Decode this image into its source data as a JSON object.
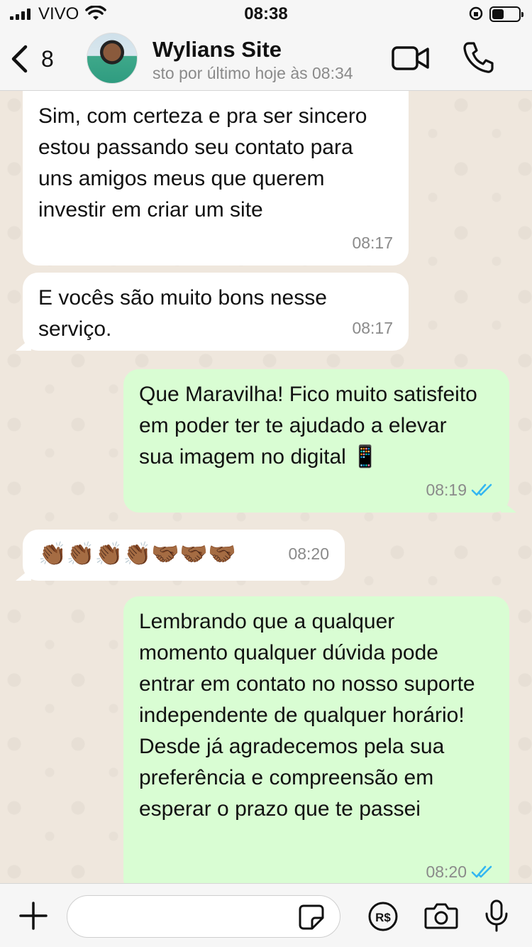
{
  "status_bar": {
    "carrier": "VIVO",
    "time": "08:38",
    "battery_level": 0.45
  },
  "header": {
    "back_count": "8",
    "contact_name": "Wylians Site",
    "contact_status": "sto por último hoje às 08:34",
    "icons": [
      "chevron-left-icon",
      "video-camera-icon",
      "phone-icon"
    ]
  },
  "messages": [
    {
      "direction": "in",
      "text": "Sim, com certeza e pra ser sincero estou passando seu contato para uns amigos meus que querem investir em criar um site",
      "time": "08:17"
    },
    {
      "direction": "in",
      "text": "E vocês são muito bons nesse serviço.",
      "time": "08:17"
    },
    {
      "direction": "out",
      "text": "Que Maravilha! Fico muito satisfeito em poder ter te ajudado a elevar sua imagem no digital 📱",
      "time": "08:19",
      "read": true
    },
    {
      "direction": "in",
      "text": "👏🏾👏🏾👏🏾👏🏾🤝🏾🤝🏾🤝🏾",
      "time": "08:20"
    },
    {
      "direction": "out",
      "text": "Lembrando que a qualquer momento qualquer dúvida pode entrar em contato no nosso suporte independente de qualquer horário! Desde já agradecemos pela sua preferência e compreensão em esperar o prazo que te passei",
      "time": "08:20",
      "read": true
    }
  ],
  "input_bar": {
    "placeholder": "",
    "icons": [
      "plus-icon",
      "sticker-icon",
      "payment-icon",
      "camera-icon",
      "microphone-icon"
    ]
  },
  "colors": {
    "incoming_bubble": "#ffffff",
    "outgoing_bubble": "#d9fdd3",
    "read_ticks": "#34b7f1",
    "chat_background": "#efe7dd"
  }
}
